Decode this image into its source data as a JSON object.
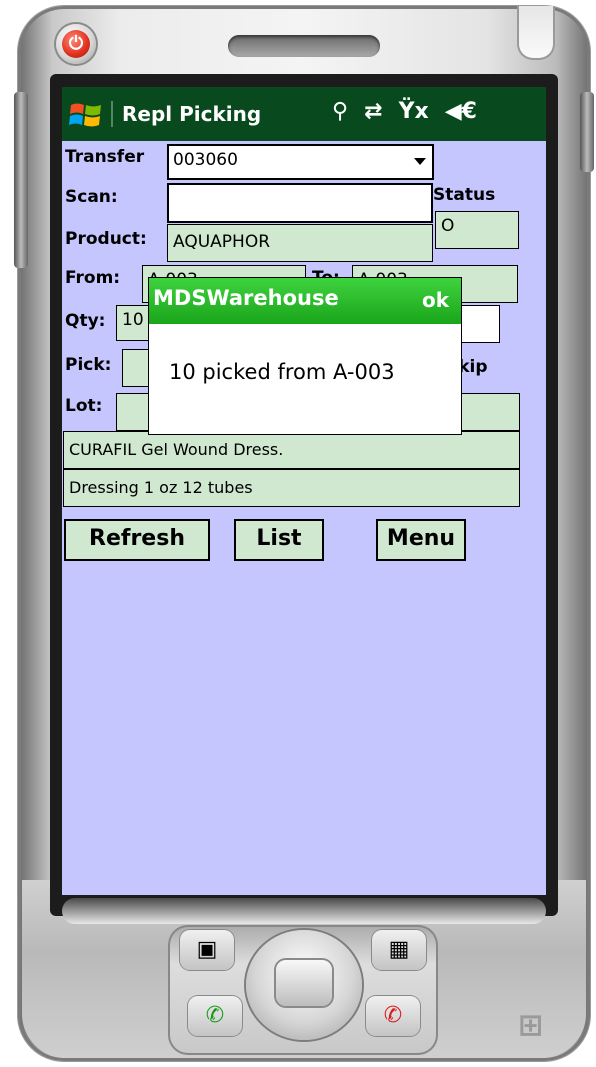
{
  "app": {
    "title": "Repl Picking",
    "status_icons": [
      "antenna-icon",
      "sync-arrows-icon",
      "no-signal-icon",
      "speaker-icon"
    ],
    "brand_colors": {
      "titlebar": "#084a1e",
      "screen_bg": "#c6c6ff",
      "field_bg": "#cfe8cf",
      "popup_head": "#1aa51a"
    }
  },
  "form": {
    "transfer_label": "Transfer",
    "transfer_value": "003060",
    "scan_label": "Scan:",
    "scan_value": "",
    "status_label": "Status",
    "status_value": "O",
    "product_label": "Product:",
    "product_value": "AQUAPHOR",
    "from_label": "From:",
    "from_value": "A-003",
    "to_label": "To:",
    "to_value": "A-003",
    "qty_label": "Qty:",
    "qty_value": "10",
    "pick_label": "Pick:",
    "skip_label": "Skip",
    "lot_label": "Lot:",
    "description_1": "CURAFIL Gel Wound Dress.",
    "description_2": "Dressing 1 oz  12 tubes"
  },
  "buttons": {
    "refresh": "Refresh",
    "list": "List",
    "menu": "Menu"
  },
  "popup": {
    "title": "MDSWarehouse",
    "ok": "ok",
    "message": "10 picked from A-003"
  }
}
